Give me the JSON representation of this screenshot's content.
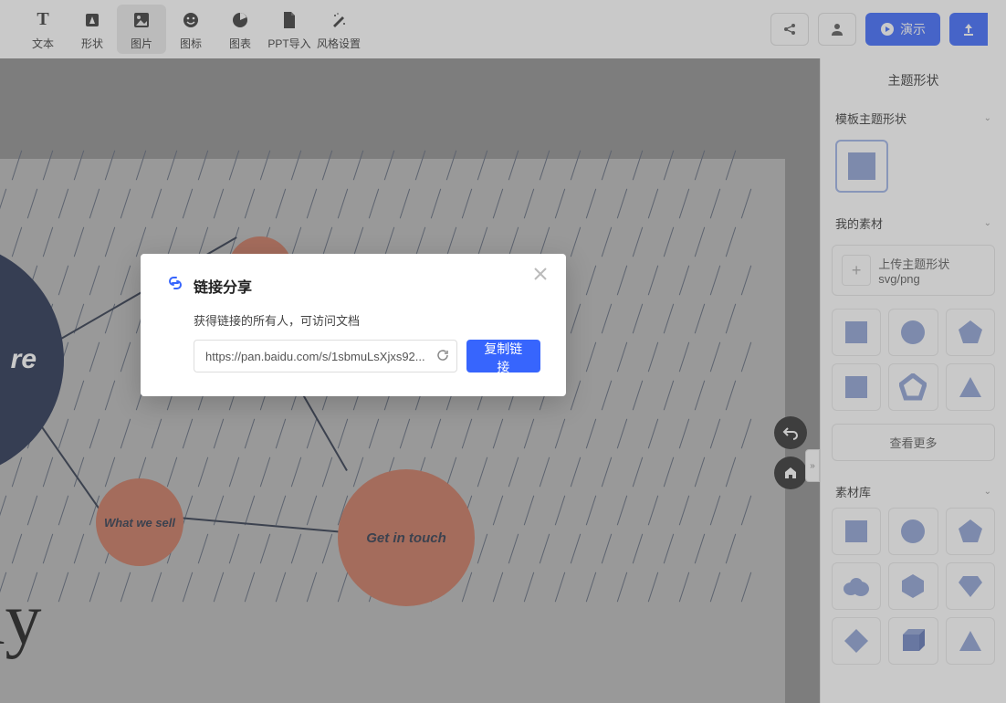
{
  "toolbar": {
    "items": [
      {
        "label": "文本",
        "icon": "T"
      },
      {
        "label": "形状",
        "icon": "shape"
      },
      {
        "label": "图片",
        "icon": "image",
        "active": true
      },
      {
        "label": "图标",
        "icon": "emoji"
      },
      {
        "label": "图表",
        "icon": "chart"
      },
      {
        "label": "PPT导入",
        "icon": "file"
      },
      {
        "label": "风格设置",
        "icon": "magic"
      }
    ],
    "present_label": "演示"
  },
  "canvas": {
    "big_circle_text": "re",
    "mid_circle_text": "What we sell",
    "right_circle_text": "Get in touch",
    "big_text": "any"
  },
  "panel": {
    "title": "主题形状",
    "section_template": "模板主题形状",
    "section_my": "我的素材",
    "upload_label": "上传主题形状svg/png",
    "see_more": "查看更多",
    "section_lib": "素材库"
  },
  "dialog": {
    "title": "链接分享",
    "desc": "获得链接的所有人，可访问文档",
    "url": "https://pan.baidu.com/s/1sbmuLsXjxs92...",
    "copy_label": "复制链接"
  }
}
